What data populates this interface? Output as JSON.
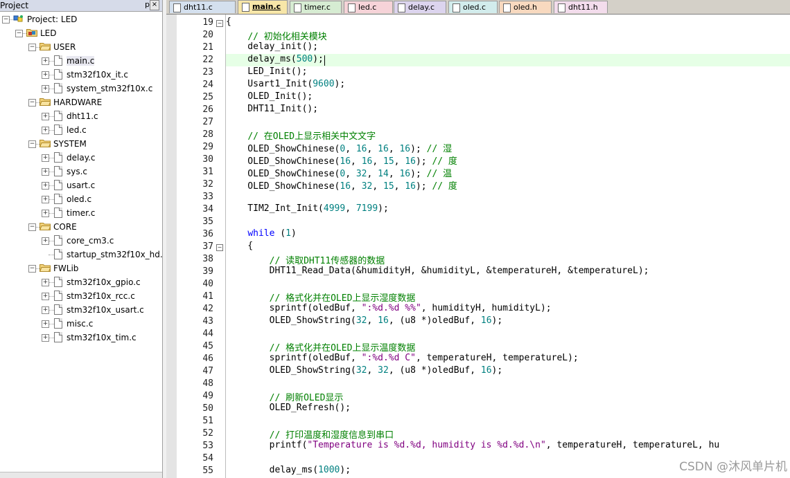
{
  "project_panel": {
    "title": "Project",
    "pin_glyph": "p",
    "close_glyph": "×",
    "tree": [
      {
        "level": 0,
        "type": "root",
        "toggle": "−",
        "label": "Project: LED"
      },
      {
        "level": 1,
        "type": "target",
        "toggle": "−",
        "label": "LED"
      },
      {
        "level": 2,
        "type": "folder",
        "toggle": "−",
        "label": "USER"
      },
      {
        "level": 3,
        "type": "file",
        "toggle": "+",
        "label": "main.c",
        "selected": true
      },
      {
        "level": 3,
        "type": "file",
        "toggle": "+",
        "label": "stm32f10x_it.c"
      },
      {
        "level": 3,
        "type": "file",
        "toggle": "+",
        "label": "system_stm32f10x.c"
      },
      {
        "level": 2,
        "type": "folder",
        "toggle": "−",
        "label": "HARDWARE"
      },
      {
        "level": 3,
        "type": "file",
        "toggle": "+",
        "label": "dht11.c"
      },
      {
        "level": 3,
        "type": "file",
        "toggle": "+",
        "label": "led.c"
      },
      {
        "level": 2,
        "type": "folder",
        "toggle": "−",
        "label": "SYSTEM"
      },
      {
        "level": 3,
        "type": "file",
        "toggle": "+",
        "label": "delay.c"
      },
      {
        "level": 3,
        "type": "file",
        "toggle": "+",
        "label": "sys.c"
      },
      {
        "level": 3,
        "type": "file",
        "toggle": "+",
        "label": "usart.c"
      },
      {
        "level": 3,
        "type": "file",
        "toggle": "+",
        "label": "oled.c"
      },
      {
        "level": 3,
        "type": "file",
        "toggle": "+",
        "label": "timer.c"
      },
      {
        "level": 2,
        "type": "folder",
        "toggle": "−",
        "label": "CORE"
      },
      {
        "level": 3,
        "type": "file",
        "toggle": "+",
        "label": "core_cm3.c"
      },
      {
        "level": 3,
        "type": "file",
        "toggle": "",
        "label": "startup_stm32f10x_hd.s"
      },
      {
        "level": 2,
        "type": "folder",
        "toggle": "−",
        "label": "FWLib"
      },
      {
        "level": 3,
        "type": "file",
        "toggle": "+",
        "label": "stm32f10x_gpio.c"
      },
      {
        "level": 3,
        "type": "file",
        "toggle": "+",
        "label": "stm32f10x_rcc.c"
      },
      {
        "level": 3,
        "type": "file",
        "toggle": "+",
        "label": "stm32f10x_usart.c"
      },
      {
        "level": 3,
        "type": "file",
        "toggle": "+",
        "label": "misc.c"
      },
      {
        "level": 3,
        "type": "file",
        "toggle": "+",
        "label": "stm32f10x_tim.c"
      }
    ]
  },
  "tabs": [
    {
      "label": "dht11.c",
      "color": "#d4e0ee",
      "active": false
    },
    {
      "label": "main.c",
      "color": "#f7e6a8",
      "active": true
    },
    {
      "label": "timer.c",
      "color": "#d6ecd2",
      "active": false
    },
    {
      "label": "led.c",
      "color": "#f6d3d8",
      "active": false
    },
    {
      "label": "delay.c",
      "color": "#dcd4ee",
      "active": false
    },
    {
      "label": "oled.c",
      "color": "#d2ecec",
      "active": false
    },
    {
      "label": "oled.h",
      "color": "#f8d9bf",
      "active": false
    },
    {
      "label": "dht11.h",
      "color": "#f3dcec",
      "active": false
    }
  ],
  "editor": {
    "current_line": 22,
    "lines": [
      {
        "no": "19",
        "fold": "−",
        "tokens": [
          {
            "t": "{",
            "c": ""
          }
        ]
      },
      {
        "no": "20",
        "tokens": [
          {
            "t": "    ",
            "c": ""
          },
          {
            "t": "// 初始化相关模块",
            "c": "cm"
          }
        ]
      },
      {
        "no": "21",
        "tokens": [
          {
            "t": "    delay_init();",
            "c": ""
          }
        ]
      },
      {
        "no": "22",
        "tokens": [
          {
            "t": "    delay_ms(",
            "c": ""
          },
          {
            "t": "500",
            "c": "num"
          },
          {
            "t": ");",
            "c": ""
          }
        ]
      },
      {
        "no": "23",
        "tokens": [
          {
            "t": "    LED_Init();",
            "c": ""
          }
        ]
      },
      {
        "no": "24",
        "tokens": [
          {
            "t": "    Usart1_Init(",
            "c": ""
          },
          {
            "t": "9600",
            "c": "num"
          },
          {
            "t": ");",
            "c": ""
          }
        ]
      },
      {
        "no": "25",
        "tokens": [
          {
            "t": "    OLED_Init();",
            "c": ""
          }
        ]
      },
      {
        "no": "26",
        "tokens": [
          {
            "t": "    DHT11_Init();",
            "c": ""
          }
        ]
      },
      {
        "no": "27",
        "tokens": []
      },
      {
        "no": "28",
        "tokens": [
          {
            "t": "    ",
            "c": ""
          },
          {
            "t": "// 在OLED上显示相关中文文字",
            "c": "cm"
          }
        ]
      },
      {
        "no": "29",
        "tokens": [
          {
            "t": "    OLED_ShowChinese(",
            "c": ""
          },
          {
            "t": "0",
            "c": "num"
          },
          {
            "t": ", ",
            "c": ""
          },
          {
            "t": "16",
            "c": "num"
          },
          {
            "t": ", ",
            "c": ""
          },
          {
            "t": "16",
            "c": "num"
          },
          {
            "t": ", ",
            "c": ""
          },
          {
            "t": "16",
            "c": "num"
          },
          {
            "t": "); ",
            "c": ""
          },
          {
            "t": "// 湿",
            "c": "cm"
          }
        ]
      },
      {
        "no": "30",
        "tokens": [
          {
            "t": "    OLED_ShowChinese(",
            "c": ""
          },
          {
            "t": "16",
            "c": "num"
          },
          {
            "t": ", ",
            "c": ""
          },
          {
            "t": "16",
            "c": "num"
          },
          {
            "t": ", ",
            "c": ""
          },
          {
            "t": "15",
            "c": "num"
          },
          {
            "t": ", ",
            "c": ""
          },
          {
            "t": "16",
            "c": "num"
          },
          {
            "t": "); ",
            "c": ""
          },
          {
            "t": "// 度",
            "c": "cm"
          }
        ]
      },
      {
        "no": "31",
        "tokens": [
          {
            "t": "    OLED_ShowChinese(",
            "c": ""
          },
          {
            "t": "0",
            "c": "num"
          },
          {
            "t": ", ",
            "c": ""
          },
          {
            "t": "32",
            "c": "num"
          },
          {
            "t": ", ",
            "c": ""
          },
          {
            "t": "14",
            "c": "num"
          },
          {
            "t": ", ",
            "c": ""
          },
          {
            "t": "16",
            "c": "num"
          },
          {
            "t": "); ",
            "c": ""
          },
          {
            "t": "// 温",
            "c": "cm"
          }
        ]
      },
      {
        "no": "32",
        "tokens": [
          {
            "t": "    OLED_ShowChinese(",
            "c": ""
          },
          {
            "t": "16",
            "c": "num"
          },
          {
            "t": ", ",
            "c": ""
          },
          {
            "t": "32",
            "c": "num"
          },
          {
            "t": ", ",
            "c": ""
          },
          {
            "t": "15",
            "c": "num"
          },
          {
            "t": ", ",
            "c": ""
          },
          {
            "t": "16",
            "c": "num"
          },
          {
            "t": "); ",
            "c": ""
          },
          {
            "t": "// 度",
            "c": "cm"
          }
        ]
      },
      {
        "no": "33",
        "tokens": []
      },
      {
        "no": "34",
        "tokens": [
          {
            "t": "    TIM2_Int_Init(",
            "c": ""
          },
          {
            "t": "4999",
            "c": "num"
          },
          {
            "t": ", ",
            "c": ""
          },
          {
            "t": "7199",
            "c": "num"
          },
          {
            "t": ");",
            "c": ""
          }
        ]
      },
      {
        "no": "35",
        "tokens": []
      },
      {
        "no": "36",
        "tokens": [
          {
            "t": "    ",
            "c": ""
          },
          {
            "t": "while",
            "c": "kw"
          },
          {
            "t": " (",
            "c": ""
          },
          {
            "t": "1",
            "c": "num"
          },
          {
            "t": ")",
            "c": ""
          }
        ]
      },
      {
        "no": "37",
        "fold": "−",
        "tokens": [
          {
            "t": "    {",
            "c": ""
          }
        ]
      },
      {
        "no": "38",
        "tokens": [
          {
            "t": "        ",
            "c": ""
          },
          {
            "t": "// 读取DHT11传感器的数据",
            "c": "cm"
          }
        ]
      },
      {
        "no": "39",
        "tokens": [
          {
            "t": "        DHT11_Read_Data(&humidityH, &humidityL, &temperatureH, &temperatureL);",
            "c": ""
          }
        ]
      },
      {
        "no": "40",
        "tokens": []
      },
      {
        "no": "41",
        "tokens": [
          {
            "t": "        ",
            "c": ""
          },
          {
            "t": "// 格式化并在OLED上显示湿度数据",
            "c": "cm"
          }
        ]
      },
      {
        "no": "42",
        "tokens": [
          {
            "t": "        sprintf(oledBuf, ",
            "c": ""
          },
          {
            "t": "\":%d.%d %%\"",
            "c": "str"
          },
          {
            "t": ", humidityH, humidityL);",
            "c": ""
          }
        ]
      },
      {
        "no": "43",
        "tokens": [
          {
            "t": "        OLED_ShowString(",
            "c": ""
          },
          {
            "t": "32",
            "c": "num"
          },
          {
            "t": ", ",
            "c": ""
          },
          {
            "t": "16",
            "c": "num"
          },
          {
            "t": ", (u8 *)oledBuf, ",
            "c": ""
          },
          {
            "t": "16",
            "c": "num"
          },
          {
            "t": ");",
            "c": ""
          }
        ]
      },
      {
        "no": "44",
        "tokens": []
      },
      {
        "no": "45",
        "tokens": [
          {
            "t": "        ",
            "c": ""
          },
          {
            "t": "// 格式化并在OLED上显示温度数据",
            "c": "cm"
          }
        ]
      },
      {
        "no": "46",
        "tokens": [
          {
            "t": "        sprintf(oledBuf, ",
            "c": ""
          },
          {
            "t": "\":%d.%d C\"",
            "c": "str"
          },
          {
            "t": ", temperatureH, temperatureL);",
            "c": ""
          }
        ]
      },
      {
        "no": "47",
        "tokens": [
          {
            "t": "        OLED_ShowString(",
            "c": ""
          },
          {
            "t": "32",
            "c": "num"
          },
          {
            "t": ", ",
            "c": ""
          },
          {
            "t": "32",
            "c": "num"
          },
          {
            "t": ", (u8 *)oledBuf, ",
            "c": ""
          },
          {
            "t": "16",
            "c": "num"
          },
          {
            "t": ");",
            "c": ""
          }
        ]
      },
      {
        "no": "48",
        "tokens": []
      },
      {
        "no": "49",
        "tokens": [
          {
            "t": "        ",
            "c": ""
          },
          {
            "t": "// 刷新OLED显示",
            "c": "cm"
          }
        ]
      },
      {
        "no": "50",
        "tokens": [
          {
            "t": "        OLED_Refresh();",
            "c": ""
          }
        ]
      },
      {
        "no": "51",
        "tokens": []
      },
      {
        "no": "52",
        "tokens": [
          {
            "t": "        ",
            "c": ""
          },
          {
            "t": "// 打印温度和湿度信息到串口",
            "c": "cm"
          }
        ]
      },
      {
        "no": "53",
        "tokens": [
          {
            "t": "        printf(",
            "c": ""
          },
          {
            "t": "\"Temperature is %d.%d, humidity is %d.%d.\\n\"",
            "c": "str"
          },
          {
            "t": ", temperatureH, temperatureL, hu",
            "c": ""
          }
        ]
      },
      {
        "no": "54",
        "tokens": []
      },
      {
        "no": "55",
        "tokens": [
          {
            "t": "        delay_ms(",
            "c": ""
          },
          {
            "t": "1000",
            "c": "num"
          },
          {
            "t": ");",
            "c": ""
          }
        ]
      }
    ]
  },
  "watermark": "CSDN @沐风单片机",
  "colors": {
    "comment": "#008000",
    "keyword": "#0000ff",
    "number": "#008080",
    "string": "#800080",
    "current_line": "#e6ffe6"
  }
}
